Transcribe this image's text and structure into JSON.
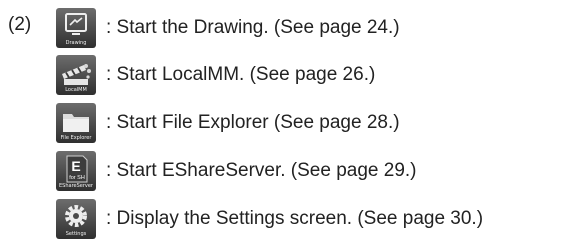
{
  "item_number": "(2)",
  "entries": [
    {
      "icon": "drawing-icon",
      "icon_caption": "Drawing",
      "text": ": Start the Drawing. (See page 24.)"
    },
    {
      "icon": "localmm-icon",
      "icon_caption": "LocalMM",
      "text": ": Start LocalMM. (See page 26.)"
    },
    {
      "icon": "file-explorer-icon",
      "icon_caption": "File Explorer",
      "text": ": Start File Explorer (See page 28.)"
    },
    {
      "icon": "eshareserver-icon",
      "icon_caption": "EShareServer",
      "text": ": Start EShareServer. (See page 29.)",
      "icon_glyph": "E",
      "icon_subglyph": "for SH"
    },
    {
      "icon": "settings-icon",
      "icon_caption": "Settings",
      "text": ": Display the Settings screen. (See page 30.)"
    }
  ]
}
